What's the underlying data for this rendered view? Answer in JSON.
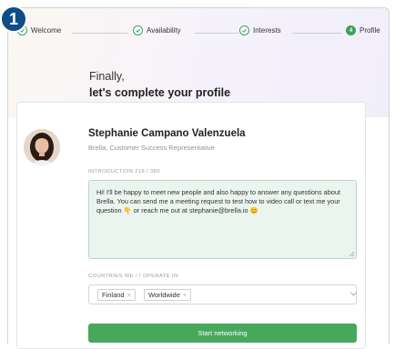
{
  "badge": "1",
  "stepper": {
    "steps": [
      {
        "label": "Welcome",
        "state": "done"
      },
      {
        "label": "Availability",
        "state": "done"
      },
      {
        "label": "Interests",
        "state": "done"
      },
      {
        "label": "Profile",
        "state": "active",
        "number": "4"
      }
    ]
  },
  "header": {
    "line1": "Finally,",
    "line2": "let's complete your profile"
  },
  "profile": {
    "name": "Stephanie Campano Valenzuela",
    "role": "Brella, Customer Success Representative"
  },
  "introduction": {
    "label": "INTRODUCTION 218 / 380",
    "text": "Hi! I'll be happy to meet new people and also happy to answer any questions about Brella. You can send me a meeting request to test how to video call or text me your question 👇 or reach me out at stephanie@brella.io 😊"
  },
  "countries": {
    "label": "COUNTRIES WE / I OPERATE IN",
    "tags": [
      "Finland",
      "Worldwide"
    ],
    "remove_glyph": "×"
  },
  "cta": {
    "label": "Start networking"
  },
  "colors": {
    "accent": "#3aa35a",
    "button": "#47a85c",
    "badge": "#0f4d86"
  }
}
